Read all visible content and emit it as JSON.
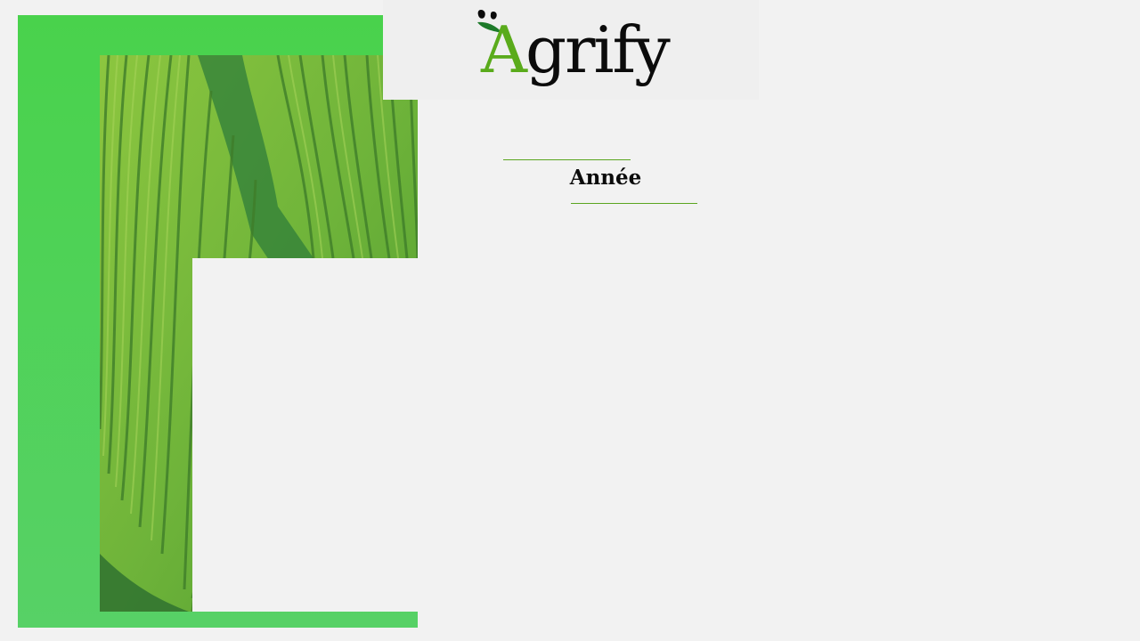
{
  "brand": {
    "logo_text_prefix": "A",
    "logo_text_rest": "grify",
    "accent_color": "#5aab1b",
    "panel_color": "#49d24c"
  },
  "header": {
    "section_label": "Année"
  },
  "hero": {
    "image_subject": "rice-terraces"
  }
}
